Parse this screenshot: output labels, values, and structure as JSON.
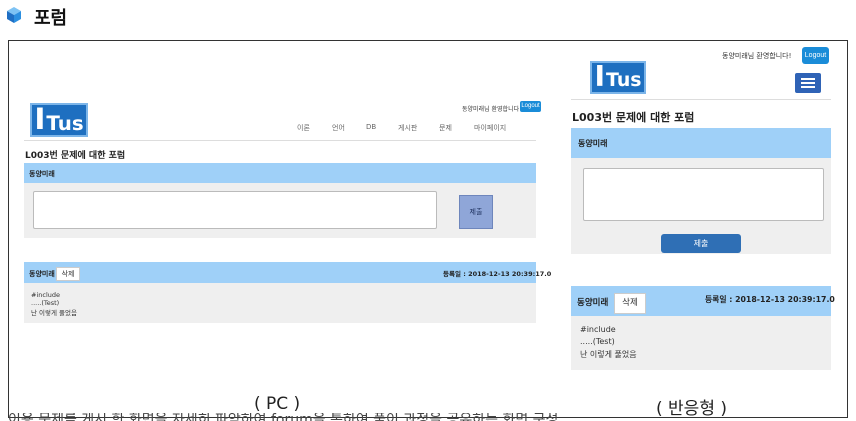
{
  "page": {
    "heading": "포럼",
    "heading_icon": "cube-icon"
  },
  "pc": {
    "welcome": "동양미래님 환영합니다",
    "logout": "Logout",
    "logo": {
      "big": "I",
      "small": "Tus"
    },
    "nav": [
      "이론",
      "언어",
      "DB",
      "게시판",
      "문제",
      "마이페이지"
    ],
    "title": "L003번 문제에 대한 포럼",
    "author": "동양미래",
    "submit": "제출",
    "comment": {
      "name": "동양미래",
      "delete": "삭제",
      "date": "등록일 : 2018-12-13 20:39:17.0",
      "lines": [
        "#include",
        ".....(Test)",
        "난 이렇게 풀었음"
      ]
    },
    "caption": "( PC )"
  },
  "mobile": {
    "welcome": "동양미래님 환영합니다!",
    "logout": "Logout",
    "logo": {
      "big": "I",
      "small": "Tus"
    },
    "menu_icon": "hamburger-icon",
    "title": "L003번 문제에 대한 포럼",
    "author": "동양미래",
    "submit": "제출",
    "comment": {
      "name": "동양미래",
      "delete": "삭제",
      "date": "등록일 : 2018-12-13 20:39:17.0",
      "lines": [
        "#include",
        ".....(Test)",
        "난 이렇게 풀었음"
      ]
    },
    "caption": "( 반응형 )"
  },
  "footer_text": "이용 문제를 게시 한 화면을 자세히 파악하여 forum을 통하여 풀이 과정을 공유하는 화면 구성"
}
